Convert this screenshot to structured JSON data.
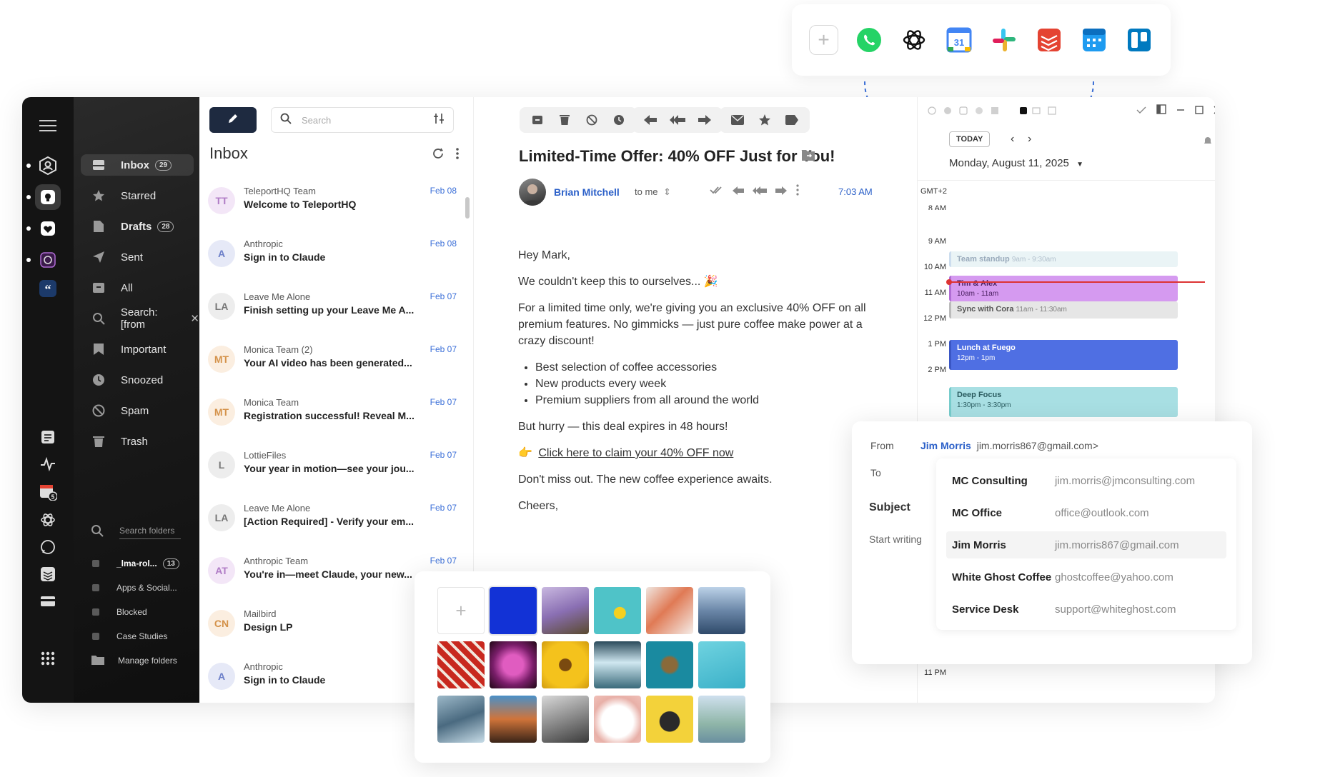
{
  "integrations": {
    "add_label": "+",
    "apps": [
      {
        "name": "whatsapp-icon",
        "color": "#25D366"
      },
      {
        "name": "openai-icon",
        "color": "#111111"
      },
      {
        "name": "google-calendar-icon",
        "color": "#4285F4"
      },
      {
        "name": "slack-icon",
        "color": "#E01E5A"
      },
      {
        "name": "todoist-icon",
        "color": "#E44332"
      },
      {
        "name": "calendar-app-icon",
        "color": "#1E9BF0"
      },
      {
        "name": "trello-icon",
        "color": "#0079BF"
      }
    ]
  },
  "rail": {
    "icons": [
      "accounts-icon",
      "lightbulb-icon",
      "heart-icon",
      "message-icon",
      "quote-icon",
      "notes-icon",
      "activity-icon",
      "calendar-icon",
      "openai-icon",
      "whatsapp-icon",
      "todoist-icon",
      "card-icon",
      "apps-grid-icon"
    ],
    "calendar_badge": "5"
  },
  "sidebar": {
    "folders": [
      {
        "label": "Inbox",
        "count": "29",
        "icon": "inbox-icon"
      },
      {
        "label": "Starred",
        "icon": "star-icon"
      },
      {
        "label": "Drafts",
        "count": "28",
        "icon": "draft-icon"
      },
      {
        "label": "Sent",
        "icon": "send-icon"
      },
      {
        "label": "All",
        "icon": "archive-icon"
      },
      {
        "label": "Search: [from",
        "icon": "search-icon"
      },
      {
        "label": "Important",
        "icon": "important-icon"
      },
      {
        "label": "Snoozed",
        "icon": "clock-icon"
      },
      {
        "label": "Spam",
        "icon": "spam-icon"
      },
      {
        "label": "Trash",
        "icon": "trash-icon"
      }
    ],
    "search_placeholder": "Search folders",
    "subfolders": [
      {
        "label": "_lma-rol...",
        "count": "13"
      },
      {
        "label": "Apps & Social..."
      },
      {
        "label": "Blocked"
      },
      {
        "label": "Case Studies"
      }
    ],
    "manage_label": "Manage folders"
  },
  "list": {
    "search_placeholder": "Search",
    "title": "Inbox",
    "messages": [
      {
        "initials": "TT",
        "from": "TeleportHQ Team",
        "subject": "Welcome to TeleportHQ",
        "date": "Feb 08",
        "bg": "#f3e6f7",
        "fg": "#b07cc6"
      },
      {
        "initials": "A",
        "from": "Anthropic",
        "subject": "Sign in to Claude",
        "date": "Feb 08",
        "bg": "#e6e9f7",
        "fg": "#6c7fc9"
      },
      {
        "initials": "LA",
        "from": "Leave Me Alone",
        "subject": "Finish setting up your Leave Me A...",
        "date": "Feb 07",
        "bg": "#ededed",
        "fg": "#777777"
      },
      {
        "initials": "MT",
        "from": "Monica Team  (2)",
        "subject": "Your AI video has been generated...",
        "date": "Feb 07",
        "bg": "#fbeee0",
        "fg": "#d4924a"
      },
      {
        "initials": "MT",
        "from": "Monica Team",
        "subject": "Registration successful! Reveal M...",
        "date": "Feb 07",
        "bg": "#fbeee0",
        "fg": "#d4924a"
      },
      {
        "initials": "L",
        "from": "LottieFiles",
        "subject": "Your year in motion—see your jou...",
        "date": "Feb 07",
        "bg": "#ededed",
        "fg": "#777777"
      },
      {
        "initials": "LA",
        "from": "Leave Me Alone",
        "subject": "[Action Required] - Verify your em...",
        "date": "Feb 07",
        "bg": "#ededed",
        "fg": "#777777"
      },
      {
        "initials": "AT",
        "from": "Anthropic Team",
        "subject": "You're in—meet Claude, your new...",
        "date": "Feb 07",
        "bg": "#f3e6f7",
        "fg": "#b07cc6"
      },
      {
        "initials": "CN",
        "from": "Mailbird",
        "subject": "Design LP",
        "date": "",
        "bg": "#fbeee0",
        "fg": "#d4924a"
      },
      {
        "initials": "A",
        "from": "Anthropic",
        "subject": "Sign in to Claude",
        "date": "",
        "bg": "#e6e9f7",
        "fg": "#6c7fc9"
      }
    ]
  },
  "reader": {
    "subject": "Limited-Time Offer: 40% OFF Just for You!",
    "sender": "Brian Mitchell",
    "to": "to me",
    "time": "7:03 AM",
    "greeting": "Hey Mark,",
    "p1": "We couldn't keep this to ourselves... 🎉",
    "p2": "For a limited time only, we're giving you an exclusive 40% OFF on all premium features. No gimmicks — just pure coffee make power at a crazy discount!",
    "bullets": [
      "Best selection of coffee accessories",
      "New products every week",
      "Premium suppliers from all around the world"
    ],
    "p3": "But hurry — this deal expires in 48 hours!",
    "link_emoji": "👉",
    "link": "Click here to claim your 40% OFF now",
    "p4": "Don't miss out. The new coffee experience awaits.",
    "closing": "Cheers,"
  },
  "calendar": {
    "today_label": "TODAY",
    "date_label": "Monday, August 11, 2025",
    "timezone": "GMT+2",
    "hours": [
      "8 AM",
      "9 AM",
      "10 AM",
      "11 AM",
      "12 PM",
      "1 PM",
      "2 PM",
      "11 PM"
    ],
    "events": [
      {
        "title": "Team standup",
        "time": "9am - 9:30am",
        "bg": "#eaf4f6",
        "fg": "#9ab",
        "accent": "#cde"
      },
      {
        "title": "Tim & Alex",
        "time": "10am - 11am",
        "bg": "#d59af0",
        "fg": "#4a2060",
        "accent": "#b06cd4"
      },
      {
        "title": "Sync with Cora",
        "time": "11am - 11:30am",
        "bg": "#e6e6e6",
        "fg": "#555",
        "accent": "#bbb"
      },
      {
        "title": "Lunch at Fuego",
        "time": "12pm - 1pm",
        "bg": "#4f6fe3",
        "fg": "#ffffff",
        "accent": "#3a56c4"
      },
      {
        "title": "Deep Focus",
        "time": "1:30pm - 3:30pm",
        "bg": "#a8dfe3",
        "fg": "#2b5c60",
        "accent": "#7cc"
      }
    ]
  },
  "compose": {
    "from_label": "From",
    "from_name": "Jim Morris",
    "from_email": "jim.morris867@gmail.com>",
    "to_label": "To",
    "subject_label": "Subject",
    "start_placeholder": "Start writing",
    "contacts": [
      {
        "name": "MC Consulting",
        "email": "jim.morris@jmconsulting.com"
      },
      {
        "name": "MC Office",
        "email": "office@outlook.com"
      },
      {
        "name": "Jim Morris",
        "email": "jim.morris867@gmail.com"
      },
      {
        "name": "White Ghost Coffee",
        "email": "ghostcoffee@yahoo.com"
      },
      {
        "name": "Service Desk",
        "email": "support@whiteghost.com"
      }
    ]
  },
  "picker": {
    "add_label": "+",
    "images": [
      {
        "name": "solid-blue-swatch",
        "bg": "#1232d6"
      },
      {
        "name": "crocus-flowers-image",
        "bg": "linear-gradient(160deg,#c9b8e0 0%,#8a6fb3 50%,#5a4a2e 100%)"
      },
      {
        "name": "pool-float-image",
        "bg": "radial-gradient(circle at 55% 55%,#f5d020 0 16%,#4fc3c8 17% 100%)"
      },
      {
        "name": "red-berries-image",
        "bg": "linear-gradient(135deg,#f0e6e0 0%,#e07a55 45%,#f5ede8 100%)"
      },
      {
        "name": "mountain-lake-image",
        "bg": "linear-gradient(180deg,#bcd2e8 0%,#6b87a8 50%,#2f4a6a 100%)"
      },
      {
        "name": "candy-canes-image",
        "bg": "repeating-linear-gradient(45deg,#c8281e 0 8px,#f2e6dc 8px 12px)"
      },
      {
        "name": "orchid-image",
        "bg": "radial-gradient(circle at 50% 50%,#e05cc0 0 30%,#7a1e6a 60%,#200815 100%)"
      },
      {
        "name": "sunflower-image",
        "bg": "radial-gradient(circle at 50% 50%,#7a4a10 0 18%,#f4c21c 20% 65%,#d09a10 100%)"
      },
      {
        "name": "waterfall-image",
        "bg": "linear-gradient(180deg,#2a4a5a 0%,#cfe7f0 45%,#3a6a7a 100%)"
      },
      {
        "name": "sea-turtle-image",
        "bg": "radial-gradient(circle at 50% 50%,#8a6a3a 0 22%,#1a8aa0 30% 100%)"
      },
      {
        "name": "swimmer-image",
        "bg": "linear-gradient(160deg,#6fd3e0 0%,#3ab0c8 100%)"
      },
      {
        "name": "frozen-branches-image",
        "bg": "linear-gradient(160deg,#9cb8c8 0%,#4a6a80 50%,#c8dde8 100%)"
      },
      {
        "name": "desert-mountain-image",
        "bg": "linear-gradient(180deg,#4a90c8 0%,#d0743a 50%,#3a2418 100%)"
      },
      {
        "name": "vintage-camera-image",
        "bg": "linear-gradient(160deg,#d8d8d8 0%,#8a8a8a 50%,#3a3a3a 100%)"
      },
      {
        "name": "samoyed-dog-image",
        "bg": "radial-gradient(circle at 50% 55%,#ffffff 0 45%,#e8b0a8 70%,#f0c0b8 100%)"
      },
      {
        "name": "cat-yellow-image",
        "bg": "radial-gradient(circle at 50% 55%,#2a2a2a 0 28%,#f3d23a 30% 100%)"
      },
      {
        "name": "statue-of-liberty-image",
        "bg": "linear-gradient(180deg,#cfe0ee 0%,#8fb6a8 60%,#6a8fa0 100%)"
      }
    ]
  }
}
